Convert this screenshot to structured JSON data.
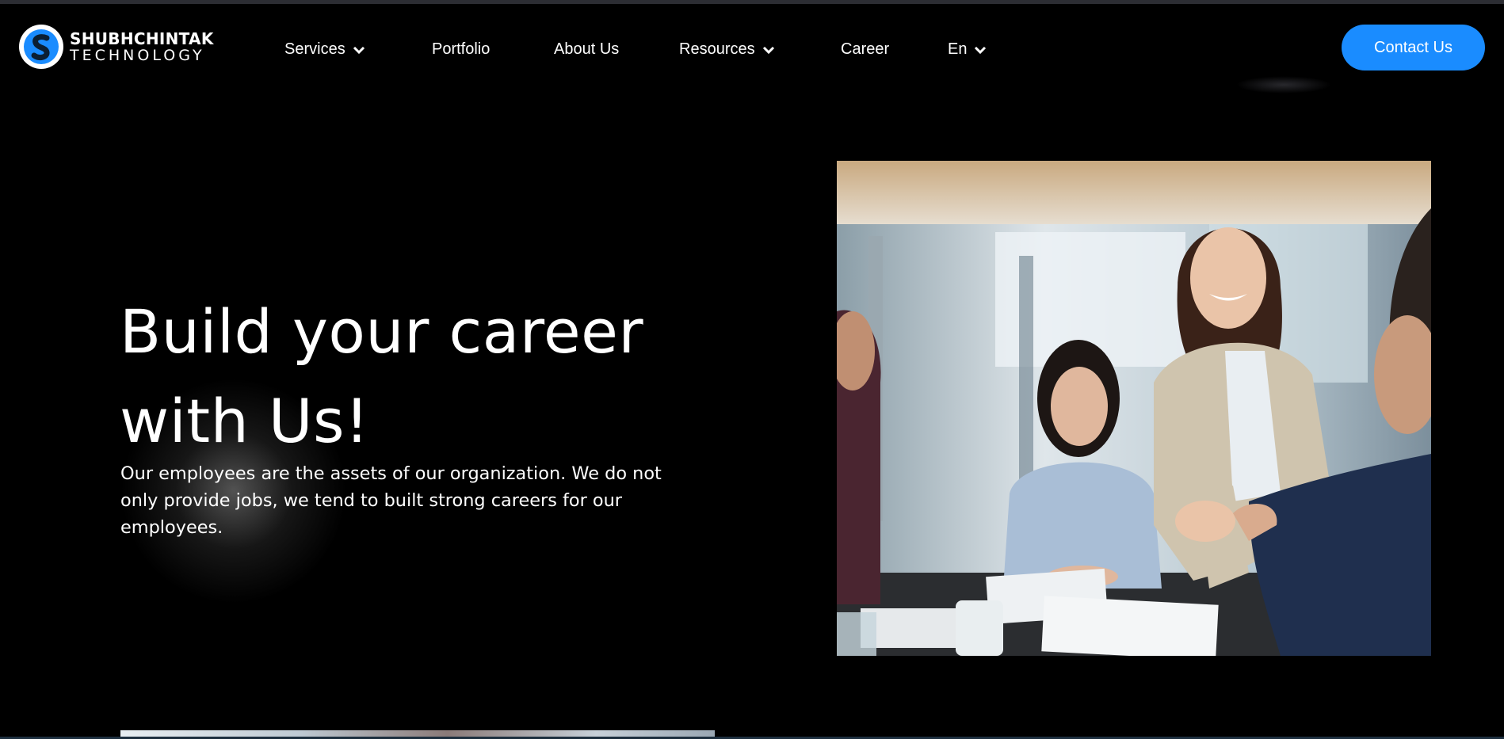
{
  "brand": {
    "name_line1": "SHUBHCHINTAK",
    "name_line2": "TECHNOLOGY",
    "accent_color": "#1a8cff"
  },
  "nav": {
    "items": [
      {
        "label": "Services",
        "has_dropdown": true
      },
      {
        "label": "Portfolio",
        "has_dropdown": false
      },
      {
        "label": "About Us",
        "has_dropdown": false
      },
      {
        "label": "Resources",
        "has_dropdown": true
      },
      {
        "label": "Career",
        "has_dropdown": false
      },
      {
        "label": "En",
        "has_dropdown": true
      }
    ],
    "cta_label": "Contact Us"
  },
  "hero": {
    "title_line1": "Build your career",
    "title_line2": "with Us!",
    "description": "Our employees are the assets of our organization. We do not only provide jobs, we tend to built strong careers for our employees.",
    "image_icon": "team-handshake-photo"
  }
}
